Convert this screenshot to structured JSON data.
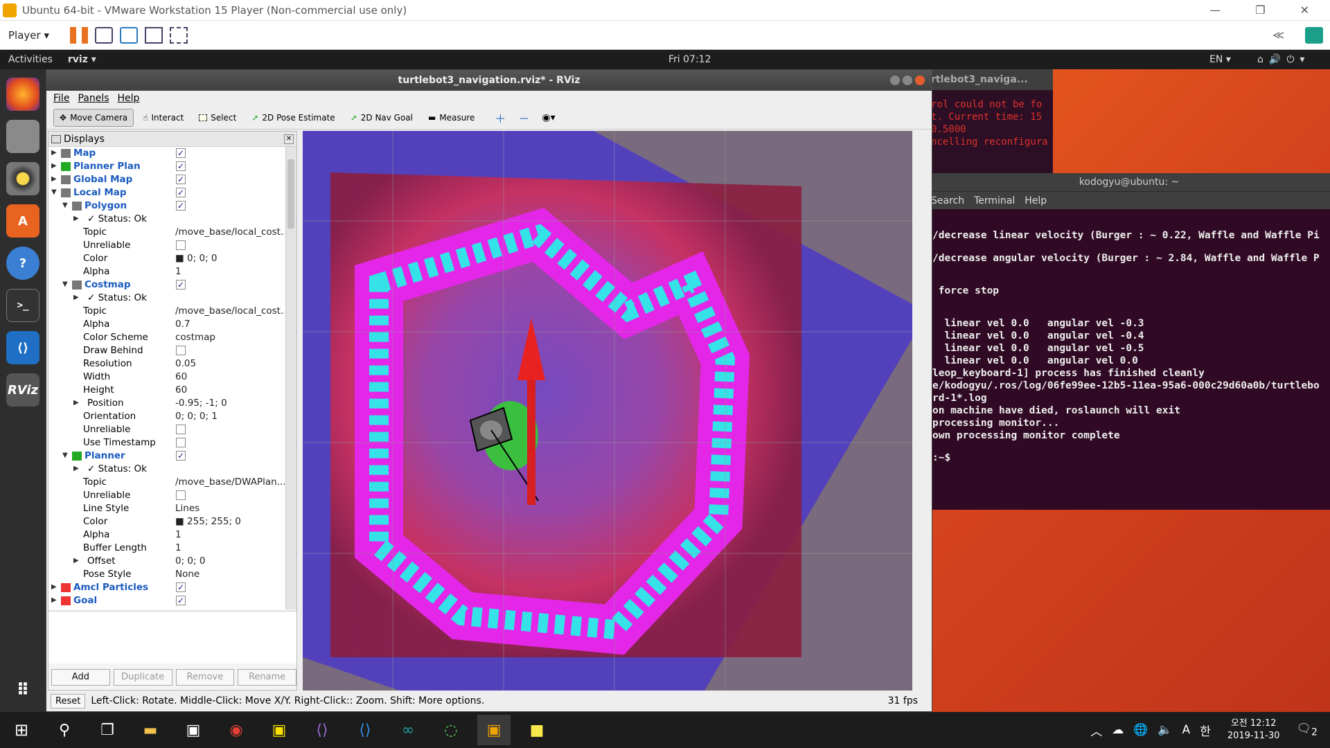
{
  "vm": {
    "title": "Ubuntu 64-bit - VMware Workstation 15 Player (Non-commercial use only)",
    "player_label": "Player",
    "controls": [
      "—",
      "❐",
      "✕"
    ]
  },
  "gnome": {
    "activities": "Activities",
    "app_name": "rviz",
    "clock": "Fri 07:12",
    "lang": "EN"
  },
  "rviz": {
    "title": "turtlebot3_navigation.rviz* - RViz",
    "menu": [
      "File",
      "Panels",
      "Help"
    ],
    "tools": [
      {
        "label": "Move Camera",
        "icon": "move-camera-icon",
        "active": true
      },
      {
        "label": "Interact",
        "icon": "interact-icon",
        "active": false
      },
      {
        "label": "Select",
        "icon": "select-icon",
        "active": false
      },
      {
        "label": "2D Pose Estimate",
        "icon": "pose-estimate-icon",
        "active": false
      },
      {
        "label": "2D Nav Goal",
        "icon": "nav-goal-icon",
        "active": false
      },
      {
        "label": "Measure",
        "icon": "measure-icon",
        "active": false
      }
    ],
    "displays_title": "Displays",
    "tree": [
      {
        "lvl": 0,
        "name": "Map",
        "chk": true,
        "arrow": "▶",
        "top": true
      },
      {
        "lvl": 0,
        "name": "Planner Plan",
        "chk": true,
        "arrow": "▶",
        "top": true
      },
      {
        "lvl": 0,
        "name": "Global Map",
        "chk": true,
        "arrow": "▶",
        "top": true
      },
      {
        "lvl": 0,
        "name": "Local Map",
        "chk": true,
        "arrow": "▼",
        "top": true
      },
      {
        "lvl": 1,
        "name": "Polygon",
        "chk": true,
        "arrow": "▼",
        "top": true
      },
      {
        "lvl": 2,
        "name": "✓ Status: Ok",
        "arrow": "▶"
      },
      {
        "lvl": 2,
        "name": "Topic",
        "val": "/move_base/local_cost..."
      },
      {
        "lvl": 2,
        "name": "Unreliable",
        "chk": false
      },
      {
        "lvl": 2,
        "name": "Color",
        "val": "■ 0; 0; 0"
      },
      {
        "lvl": 2,
        "name": "Alpha",
        "val": "1"
      },
      {
        "lvl": 1,
        "name": "Costmap",
        "chk": true,
        "arrow": "▼",
        "top": true
      },
      {
        "lvl": 2,
        "name": "✓ Status: Ok",
        "arrow": "▶"
      },
      {
        "lvl": 2,
        "name": "Topic",
        "val": "/move_base/local_cost..."
      },
      {
        "lvl": 2,
        "name": "Alpha",
        "val": "0.7"
      },
      {
        "lvl": 2,
        "name": "Color Scheme",
        "val": "costmap"
      },
      {
        "lvl": 2,
        "name": "Draw Behind",
        "chk": false
      },
      {
        "lvl": 2,
        "name": "Resolution",
        "val": "0.05"
      },
      {
        "lvl": 2,
        "name": "Width",
        "val": "60"
      },
      {
        "lvl": 2,
        "name": "Height",
        "val": "60"
      },
      {
        "lvl": 2,
        "name": "Position",
        "val": "-0.95; -1; 0",
        "arrow": "▶"
      },
      {
        "lvl": 2,
        "name": "Orientation",
        "val": "0; 0; 0; 1"
      },
      {
        "lvl": 2,
        "name": "Unreliable",
        "chk": false
      },
      {
        "lvl": 2,
        "name": "Use Timestamp",
        "chk": false
      },
      {
        "lvl": 1,
        "name": "Planner",
        "chk": true,
        "arrow": "▼",
        "top": true
      },
      {
        "lvl": 2,
        "name": "✓ Status: Ok",
        "arrow": "▶"
      },
      {
        "lvl": 2,
        "name": "Topic",
        "val": "/move_base/DWAPlan..."
      },
      {
        "lvl": 2,
        "name": "Unreliable",
        "chk": false
      },
      {
        "lvl": 2,
        "name": "Line Style",
        "val": "Lines"
      },
      {
        "lvl": 2,
        "name": "Color",
        "val": "■ 255; 255; 0"
      },
      {
        "lvl": 2,
        "name": "Alpha",
        "val": "1"
      },
      {
        "lvl": 2,
        "name": "Buffer Length",
        "val": "1"
      },
      {
        "lvl": 2,
        "name": "Offset",
        "val": "0; 0; 0",
        "arrow": "▶"
      },
      {
        "lvl": 2,
        "name": "Pose Style",
        "val": "None"
      },
      {
        "lvl": 0,
        "name": "Amcl Particles",
        "chk": true,
        "arrow": "▶",
        "top": true
      },
      {
        "lvl": 0,
        "name": "Goal",
        "chk": true,
        "arrow": "▶",
        "top": true
      }
    ],
    "buttons": {
      "add": "Add",
      "duplicate": "Duplicate",
      "remove": "Remove",
      "rename": "Rename"
    },
    "status": {
      "reset": "Reset",
      "help": "Left-Click: Rotate. Middle-Click: Move X/Y. Right-Click:: Zoom. Shift: More options.",
      "fps": "31 fps"
    }
  },
  "terminal_small": {
    "title": "rtlebot3_naviga...",
    "lines": [
      "rol could not be fo",
      "t. Current time: 15",
      "0.5000",
      "ncelling reconfigura"
    ]
  },
  "terminal": {
    "title": "kodogyu@ubuntu: ~",
    "menu": [
      "Search",
      "Terminal",
      "Help"
    ],
    "lines": [
      "",
      "",
      "/decrease linear velocity (Burger : ~ 0.22, Waffle and Waffle Pi",
      "",
      "/decrease angular velocity (Burger : ~ 2.84, Waffle and Waffle P",
      "",
      "",
      " force stop",
      "",
      "",
      "  linear vel 0.0   angular vel -0.3",
      "  linear vel 0.0   angular vel -0.4",
      "  linear vel 0.0   angular vel -0.5",
      "  linear vel 0.0   angular vel 0.0",
      "leop_keyboard-1] process has finished cleanly",
      "e/kodogyu/.ros/log/06fe99ee-12b5-11ea-95a6-000c29d60a0b/turtlebo",
      "rd-1*.log",
      "on machine have died, roslaunch will exit",
      "processing monitor...",
      "own processing monitor complete",
      "",
      ":~$ "
    ]
  },
  "taskbar": {
    "time": "오전 12:12",
    "date": "2019-11-30",
    "ime": "A",
    "korean": "한",
    "notif": "2"
  }
}
